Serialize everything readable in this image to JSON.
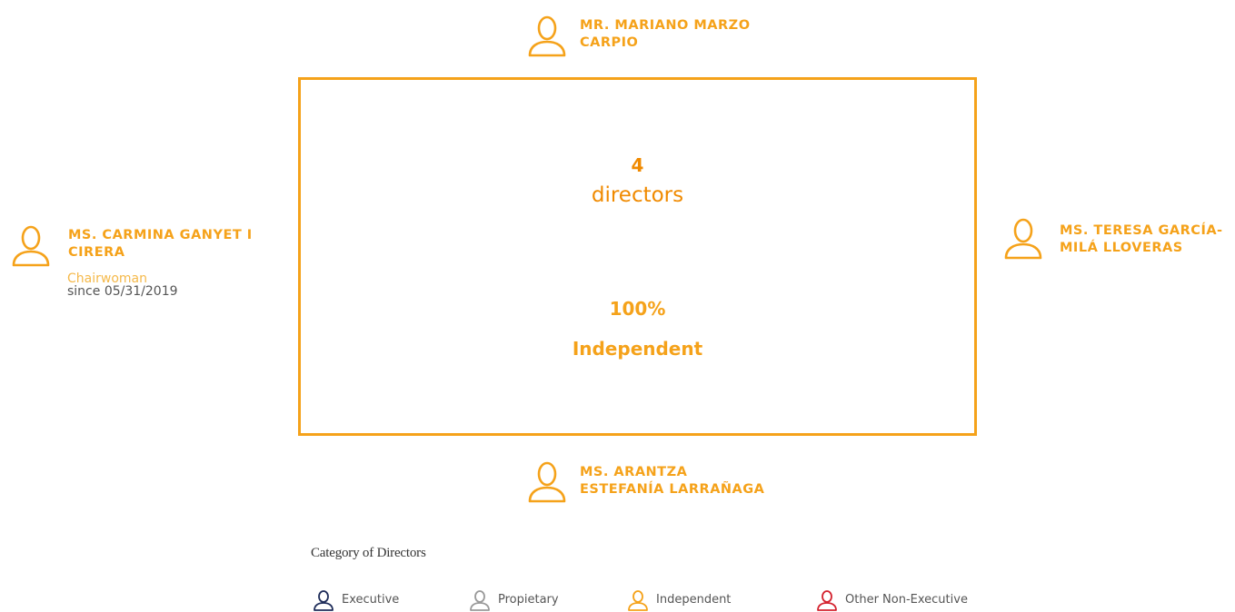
{
  "board": {
    "count": "4",
    "count_label": "directors",
    "percentage": "100%",
    "category_label": "Independent",
    "colors": {
      "independent": "#f5a21a",
      "count": "#f08a00"
    }
  },
  "directors": [
    {
      "name_line1": "MR. MARIANO MARZO",
      "name_line2": "CARPIO",
      "category": "Independent",
      "icon": "person-icon"
    },
    {
      "name_line1": "MS. CARMINA GANYET I",
      "name_line2": "CIRERA",
      "role": "Chairwoman",
      "since": "since 05/31/2019",
      "category": "Independent",
      "icon": "person-icon"
    },
    {
      "name_line1": "MS. TERESA GARCÍA-",
      "name_line2": "MILÁ LLOVERAS",
      "category": "Independent",
      "icon": "person-icon"
    },
    {
      "name_line1": "MS. ARANTZA",
      "name_line2": "ESTEFANÍA LARRAÑAGA",
      "category": "Independent",
      "icon": "person-icon"
    }
  ],
  "legend": {
    "title": "Category of Directors",
    "items": [
      {
        "label": "Executive",
        "color": "#1f2d5a",
        "icon": "person-icon"
      },
      {
        "label": "Propietary",
        "color": "#9a9a9a",
        "icon": "person-icon"
      },
      {
        "label": "Independent",
        "color": "#f5a21a",
        "icon": "person-icon"
      },
      {
        "label": "Other Non-Executive",
        "color": "#d4232f",
        "icon": "person-icon"
      }
    ]
  }
}
